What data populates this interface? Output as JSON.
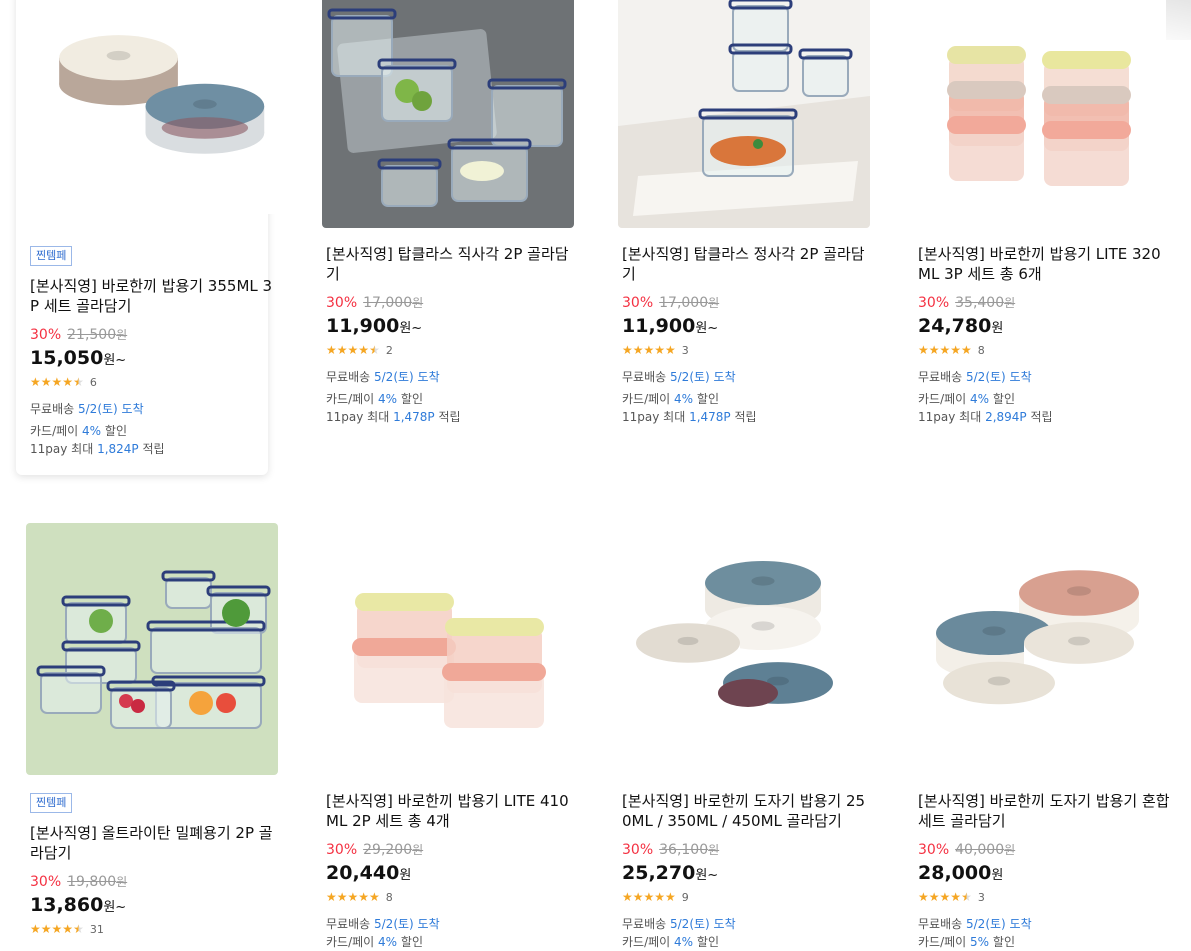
{
  "products": [
    {
      "badge": "찐템페",
      "title": "[본사직영] 바로한끼 밥용기 355ML 3P 세트 골라담기",
      "discount_rate": "30%",
      "original_price": "21,500",
      "price": "15,050",
      "price_unit": "원~",
      "rating": 4.5,
      "review_count": "6",
      "shipping_label": "무료배송",
      "delivery": "5/2(토) 도착",
      "card_label": "카드/페이",
      "card_discount": "4%",
      "card_suffix": "할인",
      "points_label": "11pay 최대",
      "points": "1,824P",
      "points_suffix": "적립",
      "thumb": "bowls-lid"
    },
    {
      "badge": "",
      "title": "[본사직영] 탑클라스 직사각 2P 골라담기",
      "discount_rate": "30%",
      "original_price": "17,000",
      "price": "11,900",
      "price_unit": "원~",
      "rating": 4.5,
      "review_count": "2",
      "shipping_label": "무료배송",
      "delivery": "5/2(토) 도착",
      "card_label": "카드/페이",
      "card_discount": "4%",
      "card_suffix": "할인",
      "points_label": "11pay 최대",
      "points": "1,478P",
      "points_suffix": "적립",
      "thumb": "glass-stone"
    },
    {
      "badge": "",
      "title": "[본사직영] 탑클라스 정사각 2P 골라담기",
      "discount_rate": "30%",
      "original_price": "17,000",
      "price": "11,900",
      "price_unit": "원~",
      "rating": 5,
      "review_count": "3",
      "shipping_label": "무료배송",
      "delivery": "5/2(토) 도착",
      "card_label": "카드/페이",
      "card_discount": "4%",
      "card_suffix": "할인",
      "points_label": "11pay 최대",
      "points": "1,478P",
      "points_suffix": "적립",
      "thumb": "glass-table"
    },
    {
      "badge": "",
      "title": "[본사직영] 바로한끼 밥용기 LITE 320ML 3P 세트 총 6개",
      "discount_rate": "30%",
      "original_price": "35,400",
      "price": "24,780",
      "price_unit": "원",
      "rating": 5,
      "review_count": "8",
      "shipping_label": "무료배송",
      "delivery": "5/2(토) 도착",
      "card_label": "카드/페이",
      "card_discount": "4%",
      "card_suffix": "할인",
      "points_label": "11pay 최대",
      "points": "2,894P",
      "points_suffix": "적립",
      "thumb": "square-stack"
    },
    {
      "badge": "찐템페",
      "title": "[본사직영] 올트라이탄 밀폐용기 2P 골라담기",
      "discount_rate": "30%",
      "original_price": "19,800",
      "price": "13,860",
      "price_unit": "원~",
      "rating": 4.5,
      "review_count": "31",
      "shipping_label": "",
      "delivery": "",
      "card_label": "",
      "card_discount": "",
      "card_suffix": "",
      "points_label": "",
      "points": "",
      "points_suffix": "",
      "thumb": "green-shelf"
    },
    {
      "badge": "",
      "title": "[본사직영] 바로한끼 밥용기 LITE 410ML 2P 세트 총 4개",
      "discount_rate": "30%",
      "original_price": "29,200",
      "price": "20,440",
      "price_unit": "원",
      "rating": 5,
      "review_count": "8",
      "shipping_label": "무료배송",
      "delivery": "5/2(토) 도착",
      "card_label": "카드/페이",
      "card_discount": "4%",
      "card_suffix": "할인",
      "points_label": "",
      "points": "",
      "points_suffix": "",
      "thumb": "square-pair"
    },
    {
      "badge": "",
      "title": "[본사직영] 바로한끼 도자기 밥용기 250ML / 350ML / 450ML 골라담기",
      "discount_rate": "30%",
      "original_price": "36,100",
      "price": "25,270",
      "price_unit": "원~",
      "rating": 5,
      "review_count": "9",
      "shipping_label": "무료배송",
      "delivery": "5/2(토) 도착",
      "card_label": "카드/페이",
      "card_discount": "4%",
      "card_suffix": "할인",
      "points_label": "",
      "points": "",
      "points_suffix": "",
      "thumb": "ceramic-three"
    },
    {
      "badge": "",
      "title": "[본사직영] 바로한끼 도자기 밥용기 혼합세트 골라담기",
      "discount_rate": "30%",
      "original_price": "40,000",
      "price": "28,000",
      "price_unit": "원",
      "rating": 4.5,
      "review_count": "3",
      "shipping_label": "무료배송",
      "delivery": "5/2(토) 도착",
      "card_label": "카드/페이",
      "card_discount": "5%",
      "card_suffix": "할인",
      "points_label": "",
      "points": "",
      "points_suffix": "",
      "thumb": "ceramic-mix"
    }
  ],
  "currency_label": "원",
  "colors": {
    "discount": "#f43142",
    "link": "#2f7bd9",
    "star": "#f5a623",
    "badge": "#2f6ccf"
  }
}
